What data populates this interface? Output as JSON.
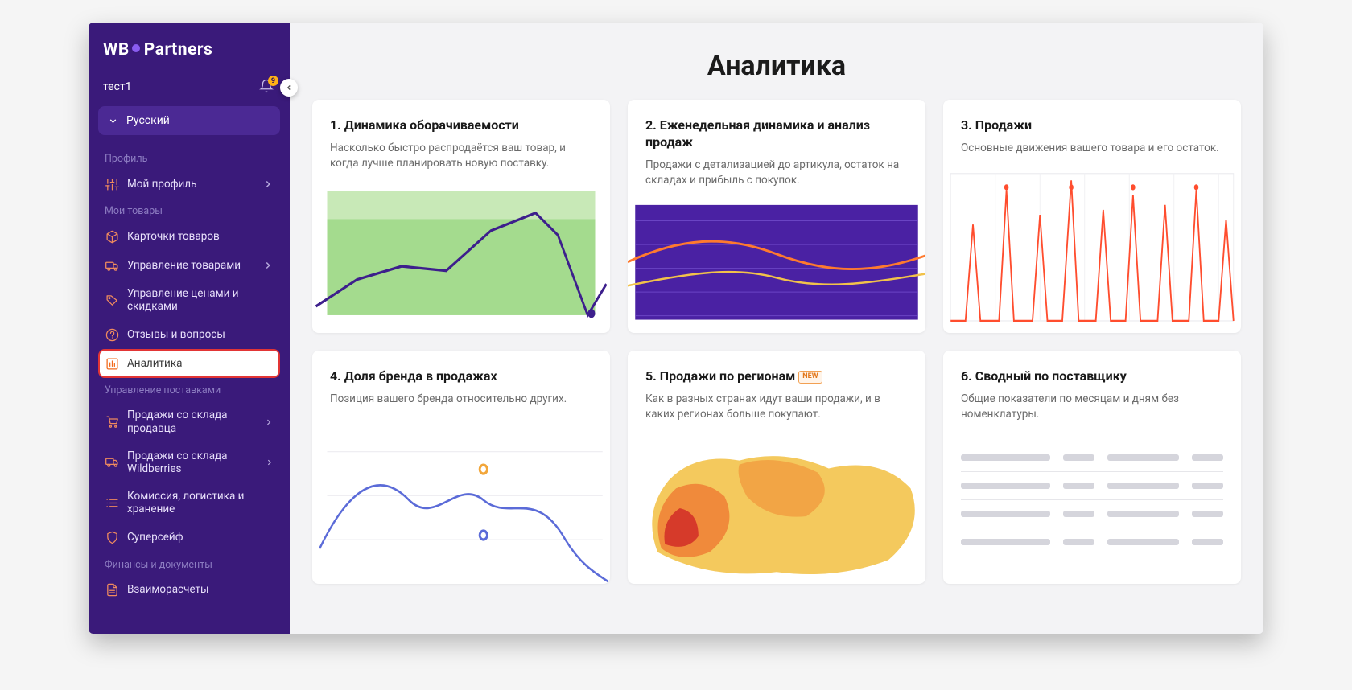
{
  "brand": {
    "part1": "WB",
    "part2": "Partners"
  },
  "user": {
    "name": "тест1",
    "notifications": "9"
  },
  "language": {
    "current": "Русский"
  },
  "sidebar": {
    "sections": [
      {
        "label": "Профиль",
        "items": [
          {
            "id": "my-profile",
            "label": "Мой профиль",
            "icon": "sliders",
            "hasChevron": true
          }
        ]
      },
      {
        "label": "Мои товары",
        "items": [
          {
            "id": "product-cards",
            "label": "Карточки товаров",
            "icon": "package",
            "hasChevron": false
          },
          {
            "id": "manage-products",
            "label": "Управление товарами",
            "icon": "truck",
            "hasChevron": true
          },
          {
            "id": "manage-prices",
            "label": "Управление ценами и скидками",
            "icon": "tag",
            "hasChevron": false
          },
          {
            "id": "reviews",
            "label": "Отзывы и вопросы",
            "icon": "help",
            "hasChevron": false
          },
          {
            "id": "analytics",
            "label": "Аналитика",
            "icon": "barchart",
            "hasChevron": false,
            "active": true
          }
        ]
      },
      {
        "label": "Управление поставками",
        "items": [
          {
            "id": "seller-warehouse",
            "label": "Продажи со склада продавца",
            "icon": "cart",
            "hasChevron": true
          },
          {
            "id": "wb-warehouse",
            "label": "Продажи со склада Wildberries",
            "icon": "delivery",
            "hasChevron": true
          },
          {
            "id": "commission",
            "label": "Комиссия, логистика и хранение",
            "icon": "list",
            "hasChevron": false
          },
          {
            "id": "supersafe",
            "label": "Суперсейф",
            "icon": "shield",
            "hasChevron": false
          }
        ]
      },
      {
        "label": "Финансы и документы",
        "items": [
          {
            "id": "settlements",
            "label": "Взаиморасчеты",
            "icon": "doc",
            "hasChevron": false
          }
        ]
      }
    ]
  },
  "page": {
    "title": "Аналитика"
  },
  "cards": [
    {
      "title": "1. Динамика оборачиваемости",
      "desc": "Насколько быстро распродаётся ваш товар, и когда лучше планировать новую поставку.",
      "viz": "turnover"
    },
    {
      "title": "2. Еженедельная динамика и анализ продаж",
      "desc": "Продажи с детализацией до артикула, остаток на складах и прибыль с покупок.",
      "viz": "weekly"
    },
    {
      "title": "3. Продажи",
      "desc": "Основные движения вашего товара и его остаток.",
      "viz": "sales"
    },
    {
      "title": "4. Доля бренда в продажах",
      "desc": "Позиция вашего бренда относительно других.",
      "viz": "brandshare"
    },
    {
      "title": "5. Продажи по регионам",
      "badge": "NEW",
      "desc": "Как в разных странах идут ваши продажи, и в каких регионах больше покупают.",
      "viz": "regions"
    },
    {
      "title": "6. Сводный по поставщику",
      "desc": "Общие показатели по месяцам и дням без номенклатуры.",
      "viz": "summary"
    }
  ]
}
